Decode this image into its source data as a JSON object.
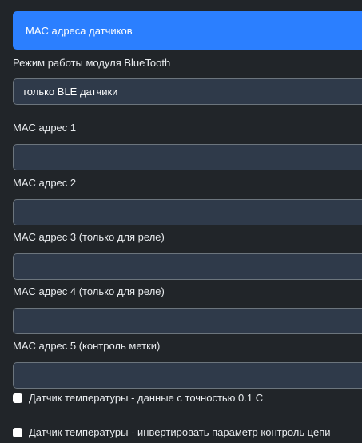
{
  "header": {
    "title": "MAC адреса датчиков"
  },
  "bluetooth": {
    "label": "Режим работы модуля BlueTooth",
    "selected": "только BLE датчики"
  },
  "mac_fields": [
    {
      "label": "MAC адрес 1",
      "value": ""
    },
    {
      "label": "MAC адрес 2",
      "value": ""
    },
    {
      "label": "MAC адрес 3 (только для реле)",
      "value": ""
    },
    {
      "label": "MAC адрес 4 (только для реле)",
      "value": ""
    },
    {
      "label": "MAC адрес 5 (контроль метки)",
      "value": ""
    }
  ],
  "checkboxes": [
    {
      "label": "Датчик температуры - данные с точностью 0.1 С",
      "checked": false
    },
    {
      "label": "Датчик температуры - инвертировать параметр контроль цепи",
      "checked": false
    }
  ]
}
